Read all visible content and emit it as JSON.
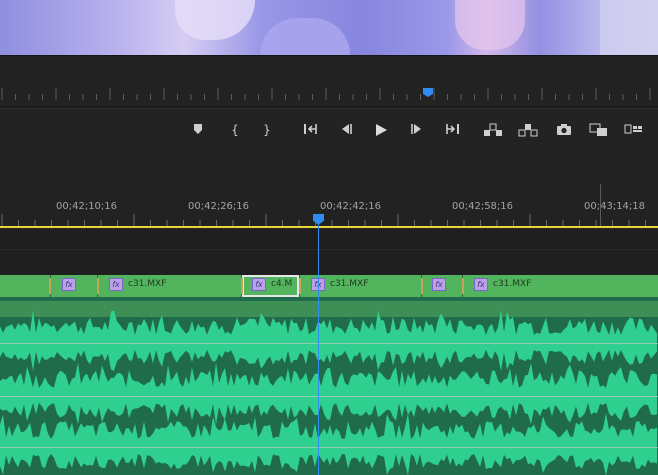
{
  "preview": {
    "description_icon": "video-frame"
  },
  "transport": {
    "buttons": [
      {
        "name": "add-marker-button",
        "icon": "marker-icon",
        "label": "▼"
      },
      {
        "name": "mark-in-button",
        "icon": "mark-in-icon",
        "label": "{"
      },
      {
        "name": "mark-out-button",
        "icon": "mark-out-icon",
        "label": "}"
      },
      {
        "name": "go-to-in-button",
        "icon": "go-to-in-icon",
        "label": ""
      },
      {
        "name": "step-back-button",
        "icon": "step-back-icon",
        "label": ""
      },
      {
        "name": "play-button",
        "icon": "play-icon",
        "label": ""
      },
      {
        "name": "step-forward-button",
        "icon": "step-forward-icon",
        "label": ""
      },
      {
        "name": "go-to-out-button",
        "icon": "go-to-out-icon",
        "label": ""
      },
      {
        "name": "lift-button",
        "icon": "lift-icon",
        "label": ""
      },
      {
        "name": "extract-button",
        "icon": "extract-icon",
        "label": ""
      },
      {
        "name": "export-frame-button",
        "icon": "camera-icon",
        "label": ""
      },
      {
        "name": "comparison-view-button",
        "icon": "comparison-icon",
        "label": ""
      },
      {
        "name": "button-editor-button",
        "icon": "button-editor-icon",
        "label": ""
      }
    ]
  },
  "timeline": {
    "timecodes": [
      "00;42;10;16",
      "00;42;26;16",
      "00;42;42;16",
      "00;42;58;16",
      "00;43;14;18"
    ],
    "clips": [
      {
        "name": "c31.MXF"
      },
      {
        "name": "c4.M"
      },
      {
        "name": "c31.MXF"
      },
      {
        "name": "c31.MXF"
      }
    ],
    "fx_label": "fx"
  },
  "colors": {
    "playhead": "#2f8cf0",
    "video_clip": "#52b45d",
    "audio_clip": "#2fcf8f",
    "work_area": "#e6d63a"
  }
}
